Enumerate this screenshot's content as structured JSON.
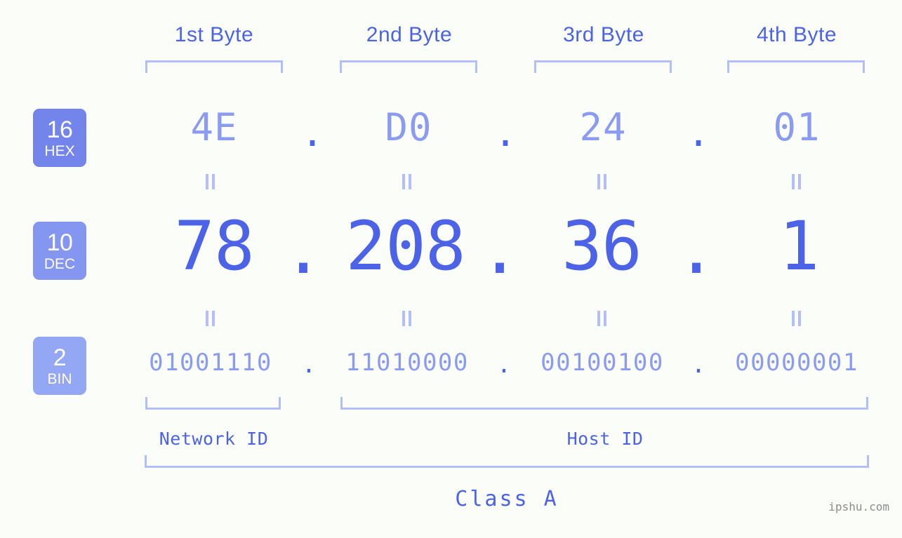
{
  "meta": {
    "watermark": "ipshu.com",
    "background_color": "#fbfdf8",
    "accent_color": "#4c63e8",
    "accent_light_color": "#8b9bf0",
    "bracket_color": "#b3befa"
  },
  "headers": {
    "byte_labels": [
      "1st Byte",
      "2nd Byte",
      "3rd Byte",
      "4th Byte"
    ]
  },
  "rows": [
    {
      "key": "hex",
      "base_number": "16",
      "base_abbr": "HEX",
      "badge_color": "#7385ea",
      "values": [
        "4E",
        "D0",
        "24",
        "01"
      ],
      "separator": "."
    },
    {
      "key": "dec",
      "base_number": "10",
      "base_abbr": "DEC",
      "badge_color": "#8496f0",
      "values": [
        "78",
        "208",
        "36",
        "1"
      ],
      "separator": "."
    },
    {
      "key": "bin",
      "base_number": "2",
      "base_abbr": "BIN",
      "badge_color": "#93a7f4",
      "values": [
        "01001110",
        "11010000",
        "00100100",
        "00000001"
      ],
      "separator": "."
    }
  ],
  "segments": {
    "network_id_label": "Network ID",
    "host_id_label": "Host ID"
  },
  "class": {
    "label": "Class A"
  },
  "chart_data": {
    "type": "table",
    "title": "IPv4 Address Byte Breakdown",
    "ip_decimal": "78.208.36.1",
    "ip_hex": "4E.D0.24.01",
    "ip_binary": "01001110.11010000.00100100.00000001",
    "address_class": "Class A",
    "network_id_bytes": [
      1
    ],
    "host_id_bytes": [
      2,
      3,
      4
    ],
    "columns": [
      "1st Byte",
      "2nd Byte",
      "3rd Byte",
      "4th Byte"
    ],
    "rows": [
      {
        "base": 16,
        "name": "HEX",
        "values": [
          "4E",
          "D0",
          "24",
          "01"
        ]
      },
      {
        "base": 10,
        "name": "DEC",
        "values": [
          "78",
          "208",
          "36",
          "1"
        ]
      },
      {
        "base": 2,
        "name": "BIN",
        "values": [
          "01001110",
          "11010000",
          "00100100",
          "00000001"
        ]
      }
    ]
  }
}
